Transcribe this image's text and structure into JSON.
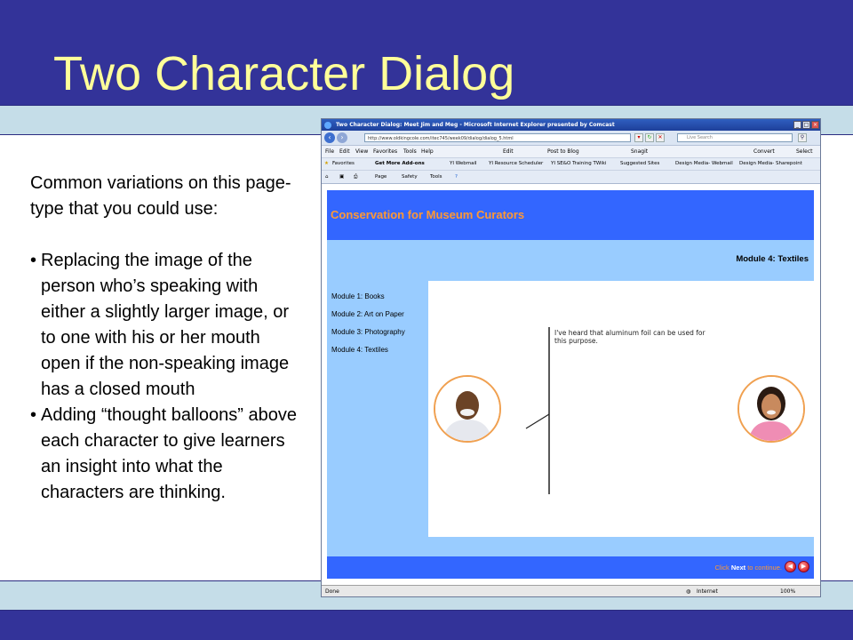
{
  "slide": {
    "title": "Two Character Dialog",
    "intro": "Common variations on this page-type that you could use:",
    "bullets": [
      "Replacing the image of the person who’s speaking with either a slightly larger image, or to one with his or her mouth open if the non-speaking image has a closed mouth",
      "Adding “thought balloons” above each character to give learners an insight into what the characters are thinking."
    ],
    "colors": {
      "band": "#333399",
      "strip": "#c5dde8",
      "title": "#ffff99"
    }
  },
  "browser": {
    "window_title": "Two Character Dialog: Meet Jim and Meg - Microsoft Internet Explorer presented by Comcast",
    "url": "http://www.oldkingcole.com/itec745/week09/dialog/dialog_5.html",
    "search_placeholder": "Live Search",
    "menu": [
      "File",
      "Edit",
      "View",
      "Favorites",
      "Tools",
      "Help"
    ],
    "menu_tools": {
      "edit": "Edit",
      "post_to_blog": "Post to Blog",
      "snagit": "Snagit",
      "convert": "Convert",
      "select": "Select"
    },
    "favorites_label": "Favorites",
    "favorites": [
      "Get More Add-ons",
      "YI Webmail",
      "YI Resource Scheduler",
      "YI SE&O Training TWiki",
      "Suggested Sites",
      "Design Media- Webmail",
      "Design Media- Sharepoint"
    ],
    "command": {
      "page": "Page",
      "safety": "Safety",
      "tools": "Tools"
    },
    "status": {
      "left": "Done",
      "zone": "Internet",
      "zoom": "100%"
    }
  },
  "course": {
    "header": "Conservation for Museum Curators",
    "module_heading": "Module 4: Textiles",
    "modules": [
      "Module 1: Books",
      "Module 2: Art on Paper",
      "Module 3: Photography",
      "Module 4: Textiles"
    ],
    "speech": "I've heard that aluminum foil can be used for this purpose.",
    "continue_prefix": "Click ",
    "continue_bold": "Next",
    "continue_suffix": " to continue.",
    "colors": {
      "header": "#3366ff",
      "background": "#99ccff",
      "accent": "#ff9933"
    }
  }
}
